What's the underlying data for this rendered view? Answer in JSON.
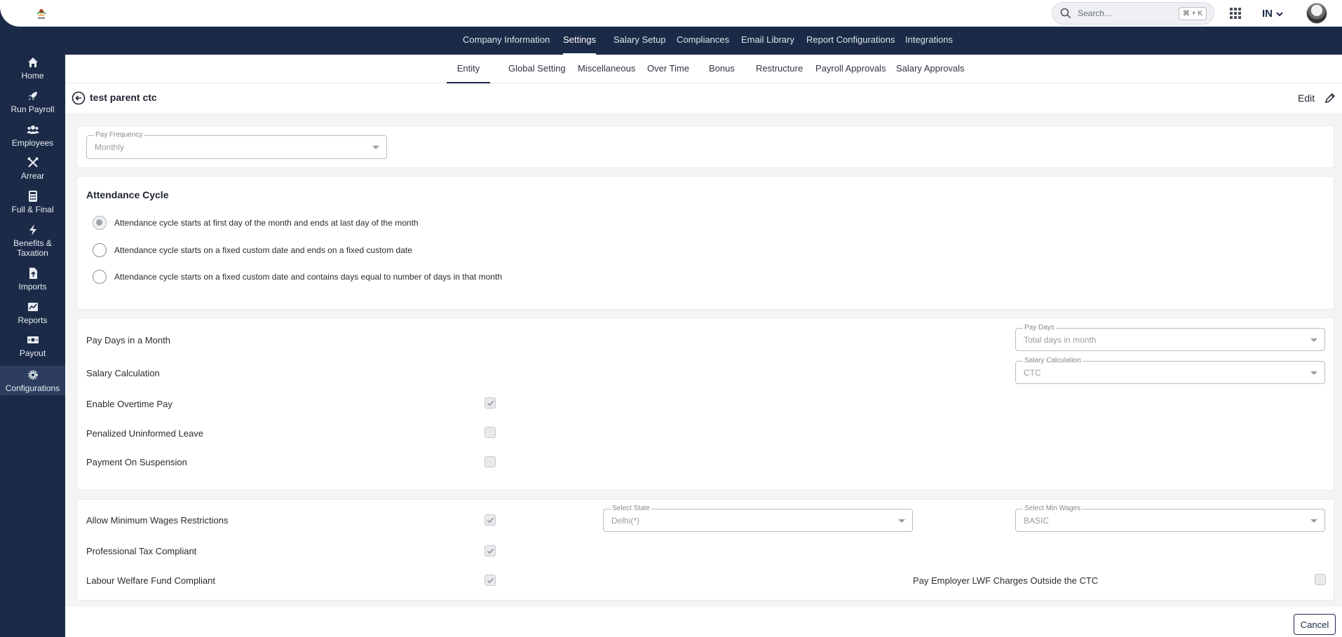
{
  "search": {
    "placeholder": "Search...",
    "shortcut": "⌘ + K"
  },
  "lang": "IN",
  "sidebar": {
    "items": [
      {
        "label": "Home",
        "icon": "home-icon"
      },
      {
        "label": "Run Payroll",
        "icon": "rocket-icon"
      },
      {
        "label": "Employees",
        "icon": "users-icon"
      },
      {
        "label": "Arrear",
        "icon": "tools-icon"
      },
      {
        "label": "Full & Final",
        "icon": "calculator-icon"
      },
      {
        "label": "Benefits &",
        "label2": "Taxation",
        "icon": "bolt-icon"
      },
      {
        "label": "Imports",
        "icon": "file-upload-icon"
      },
      {
        "label": "Reports",
        "icon": "chart-icon"
      },
      {
        "label": "Payout",
        "icon": "money-icon"
      },
      {
        "label": "Configurations",
        "icon": "gear-icon",
        "active": true
      }
    ]
  },
  "topnav": {
    "items": [
      "Company Information",
      "Settings",
      "Salary Setup",
      "Compliances",
      "Email Library",
      "Report Configurations",
      "Integrations"
    ],
    "active": "Settings"
  },
  "subnav": {
    "items": [
      "Entity",
      "Global Setting",
      "Miscellaneous",
      "Over Time",
      "Bonus",
      "Restructure",
      "Payroll Approvals",
      "Salary Approvals"
    ],
    "active": "Entity"
  },
  "header": {
    "title": "test parent ctc",
    "edit_label": "Edit"
  },
  "pay_frequency": {
    "label": "Pay Frequency",
    "value": "Monthly"
  },
  "attendance": {
    "title": "Attendance Cycle",
    "options": [
      {
        "label": "Attendance cycle starts at first day of the month and ends at last day of the month",
        "selected": true
      },
      {
        "label": "Attendance cycle starts on a fixed custom date and ends on a fixed custom date",
        "selected": false
      },
      {
        "label": "Attendance cycle starts on a fixed custom date and contains days equal to number of days in that month",
        "selected": false
      }
    ]
  },
  "pay_settings": {
    "pay_days_label": "Pay Days in a Month",
    "pay_days_field": {
      "label": "Pay Days",
      "value": "Total days in month"
    },
    "salary_calc_label": "Salary Calculation",
    "salary_calc_field": {
      "label": "Salary Calculation",
      "value": "CTC"
    },
    "overtime_label": "Enable Overtime Pay",
    "overtime_checked": true,
    "penalized_label": "Penalized Uninformed Leave",
    "penalized_checked": false,
    "suspension_label": "Payment On Suspension",
    "suspension_checked": false
  },
  "compliance": {
    "min_wages_label": "Allow Minimum Wages Restrictions",
    "min_wages_checked": true,
    "state_field": {
      "label": "Select State",
      "value": "Delhi(*)"
    },
    "min_wages_field": {
      "label": "Select Min Wages",
      "value": "BASIC"
    },
    "pt_label": "Professional Tax Compliant",
    "pt_checked": true,
    "lwf_label": "Labour Welfare Fund Compliant",
    "lwf_checked": true,
    "lwf_outside_label": "Pay Employer LWF Charges Outside the CTC",
    "lwf_outside_checked": false
  },
  "footer": {
    "cancel_label": "Cancel"
  },
  "colors": {
    "navy": "#1b2a47",
    "sidebar_active": "#2c3d5f"
  }
}
